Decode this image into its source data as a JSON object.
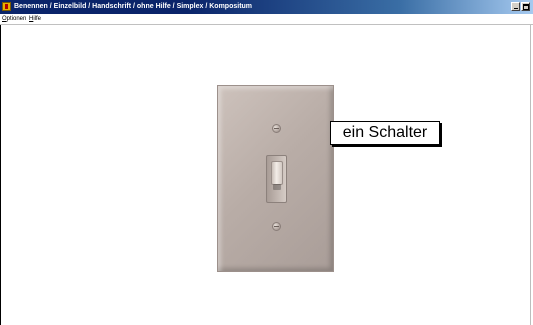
{
  "window": {
    "title": "Benennen / Einzelbild / Handschrift / ohne Hilfe / Simplex / Kompositum",
    "icon": "app-icon",
    "controls": [
      "minimize-icon",
      "maximize-icon"
    ]
  },
  "menubar": {
    "items": [
      {
        "label_underlined": "O",
        "label_rest": "ptionen"
      },
      {
        "label_underlined": "H",
        "label_rest": "ilfe"
      }
    ]
  },
  "content": {
    "image": "light-switch-image",
    "label": "ein Schalter"
  }
}
